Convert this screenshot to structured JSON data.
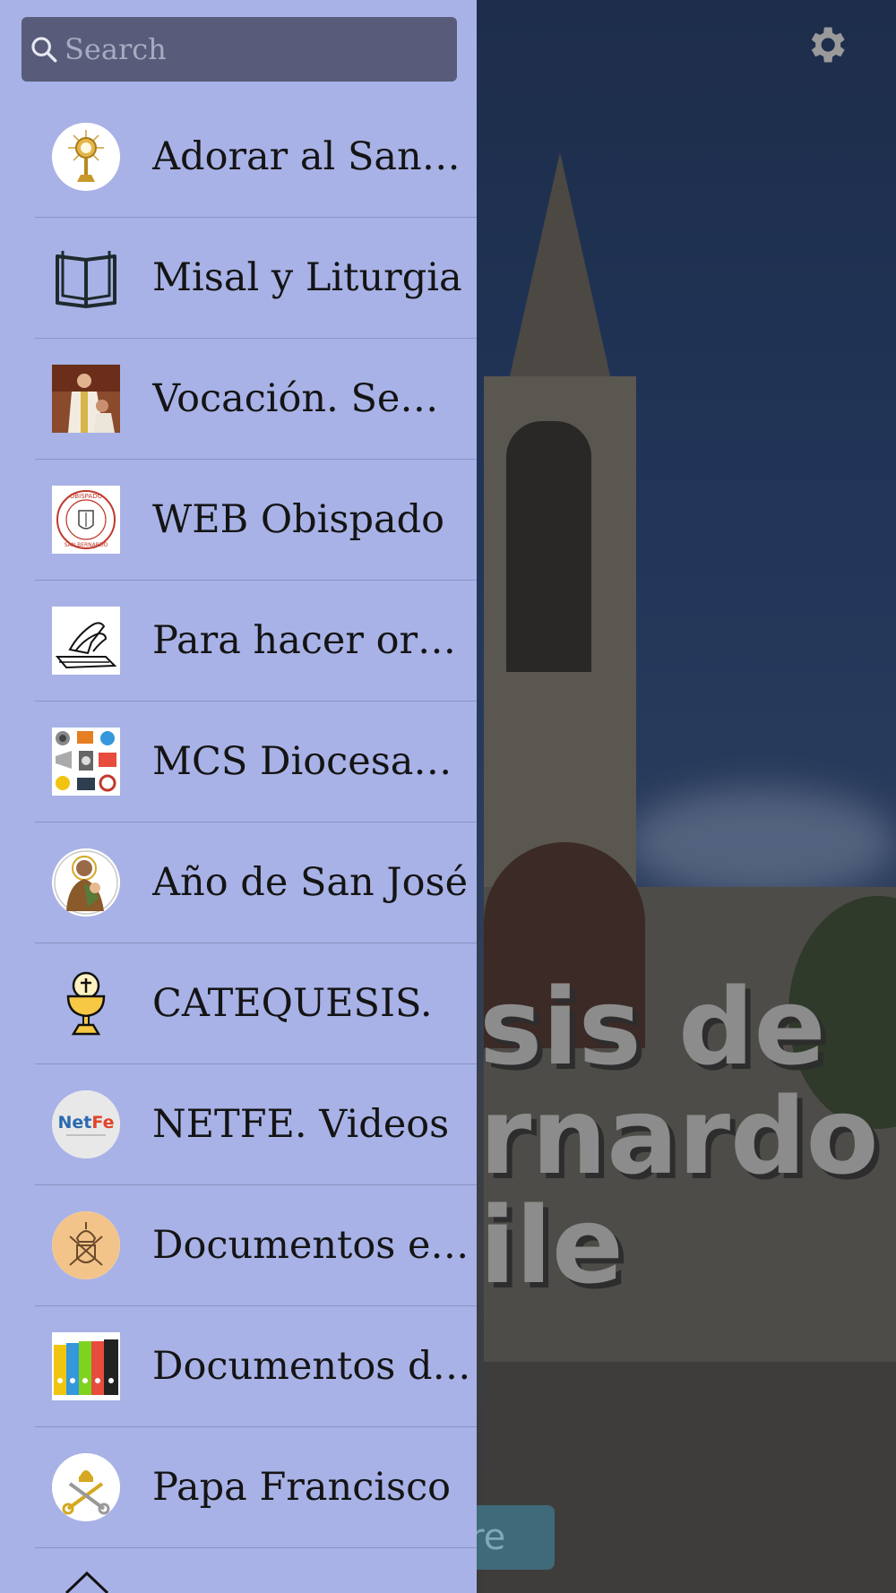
{
  "search": {
    "placeholder": "Search"
  },
  "menu": {
    "items": [
      {
        "label": "Adorar al Santísimo",
        "icon": "monstrance-icon"
      },
      {
        "label": "Misal y Liturgia",
        "icon": "open-book-icon"
      },
      {
        "label": "Vocación. Seminario",
        "icon": "ordination-photo-icon"
      },
      {
        "label": "WEB Obispado",
        "icon": "obispado-seal-icon"
      },
      {
        "label": "Para hacer oración",
        "icon": "praying-hands-icon"
      },
      {
        "label": "MCS Diocesanos",
        "icon": "media-collage-icon"
      },
      {
        "label": "Año de San José",
        "icon": "saint-joseph-icon"
      },
      {
        "label": "CATEQUESIS.",
        "icon": "chalice-icon"
      },
      {
        "label": "NETFE. Videos",
        "icon": "netfe-logo-icon"
      },
      {
        "label": "Documentos eclesiales",
        "icon": "papal-coat-of-arms-icon"
      },
      {
        "label": "Documentos diocesanos",
        "icon": "binders-icon"
      },
      {
        "label": "Papa Francisco",
        "icon": "vatican-keys-icon"
      }
    ]
  },
  "background": {
    "title_lines": "sis de\nrnardo\nile",
    "button_text": "re"
  },
  "colors": {
    "drawer": "#a8b2e6",
    "search_bg": "#585c7a"
  }
}
